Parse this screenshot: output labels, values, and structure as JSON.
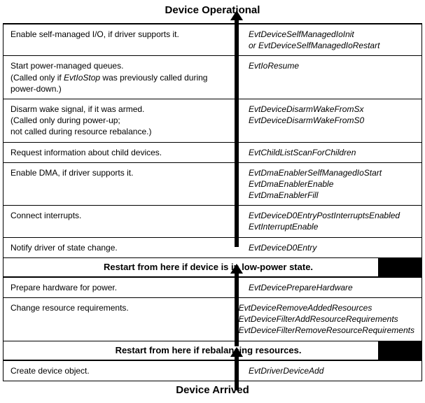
{
  "title_top": "Device Operational",
  "title_bottom": "Device Arrived",
  "section1": {
    "rows": [
      {
        "left": "Enable self-managed I/O, if driver supports it.",
        "right": "EvtDeviceSelfManagedIoInit\nor EvtDeviceSelfManagedIoRestart"
      },
      {
        "left": "Start power-managed queues.\n(Called only if EvtIoStop was previously called during power-down.)",
        "right": "EvtIoResume"
      },
      {
        "left": "Disarm wake signal, if it was armed.\n(Called only during power-up;\nnot called during resource rebalance.)",
        "right": "EvtDeviceDisarmWakeFromSx\nEvtDeviceDisarmWakeFromS0"
      },
      {
        "left": "Request information about child devices.",
        "right": "EvtChildListScanForChildren"
      },
      {
        "left": "Enable DMA, if driver supports it.",
        "right": "EvtDmaEnablerSelfManagedIoStart\nEvtDmaEnablerEnable\nEvtDmaEnablerFill"
      },
      {
        "left": "Connect interrupts.",
        "right": "EvtDeviceD0EntryPostInterruptsEnabled\nEvtInterruptEnable"
      },
      {
        "left": "Notify driver of state change.",
        "right": "EvtDeviceD0Entry"
      }
    ]
  },
  "restart1": "Restart from here if device is in low-power state.",
  "section2": {
    "rows": [
      {
        "left": "Prepare hardware for power.",
        "right": "EvtDevicePrepareHardware"
      },
      {
        "left": "Change resource requirements.",
        "right": "EvtDeviceRemoveAddedResources\nEvtDeviceFilterAddResourceRequirements\nEvtDeviceFilterRemoveResourceRequirements"
      }
    ]
  },
  "restart2": "Restart from here if rebalancing resources.",
  "section3": {
    "rows": [
      {
        "left": "Create device object.",
        "right": "EvtDriverDeviceAdd"
      }
    ]
  },
  "left_ital": {
    "0_1": "EvtIoStop"
  }
}
